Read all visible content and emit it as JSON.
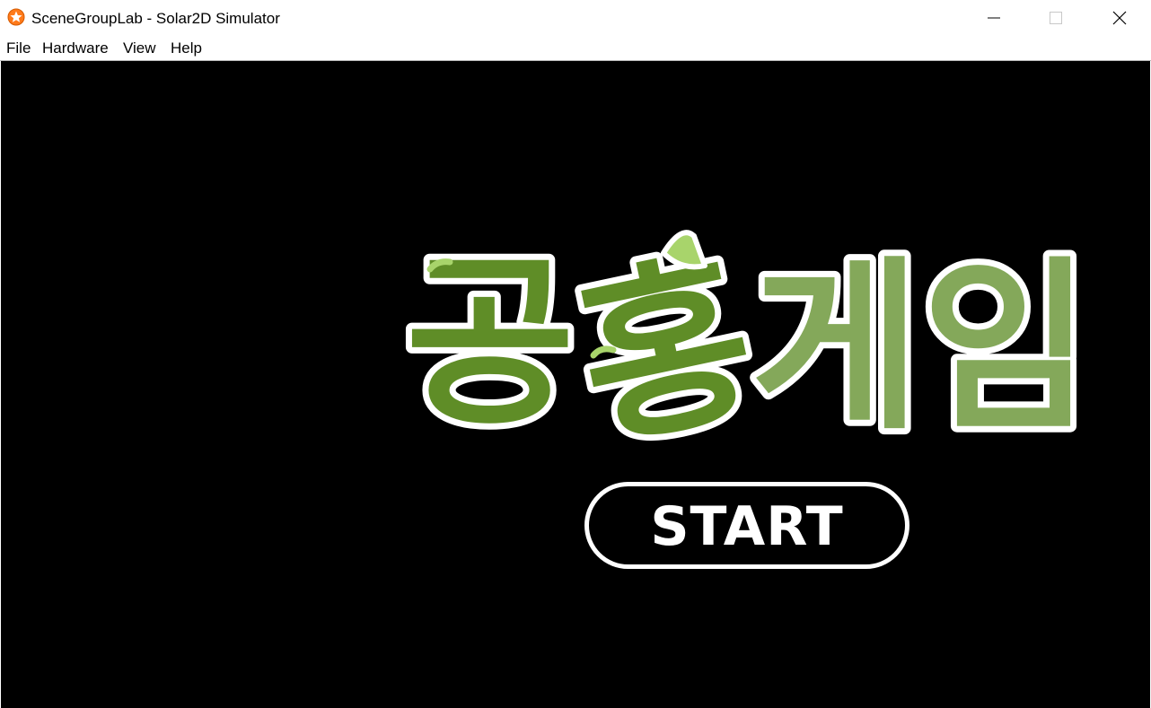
{
  "window": {
    "title": "SceneGroupLab - Solar2D Simulator",
    "app_icon": "solar2d-star-icon",
    "controls": {
      "minimize_icon": "minimize-icon",
      "maximize_icon": "maximize-icon",
      "close_icon": "close-icon"
    }
  },
  "menu": {
    "items": [
      {
        "label": "File"
      },
      {
        "label": "Hardware"
      },
      {
        "label": "View"
      },
      {
        "label": "Help"
      }
    ]
  },
  "game": {
    "logo": {
      "syllables": [
        "공",
        "홍",
        "게",
        "임"
      ],
      "colors": {
        "dark_green": "#5f8d27",
        "light_green": "#84a85a",
        "accent_green": "#a8d46b",
        "outline": "#ffffff"
      }
    },
    "start_button": {
      "label": "START",
      "border_color": "#ffffff"
    },
    "background_color": "#000000"
  }
}
